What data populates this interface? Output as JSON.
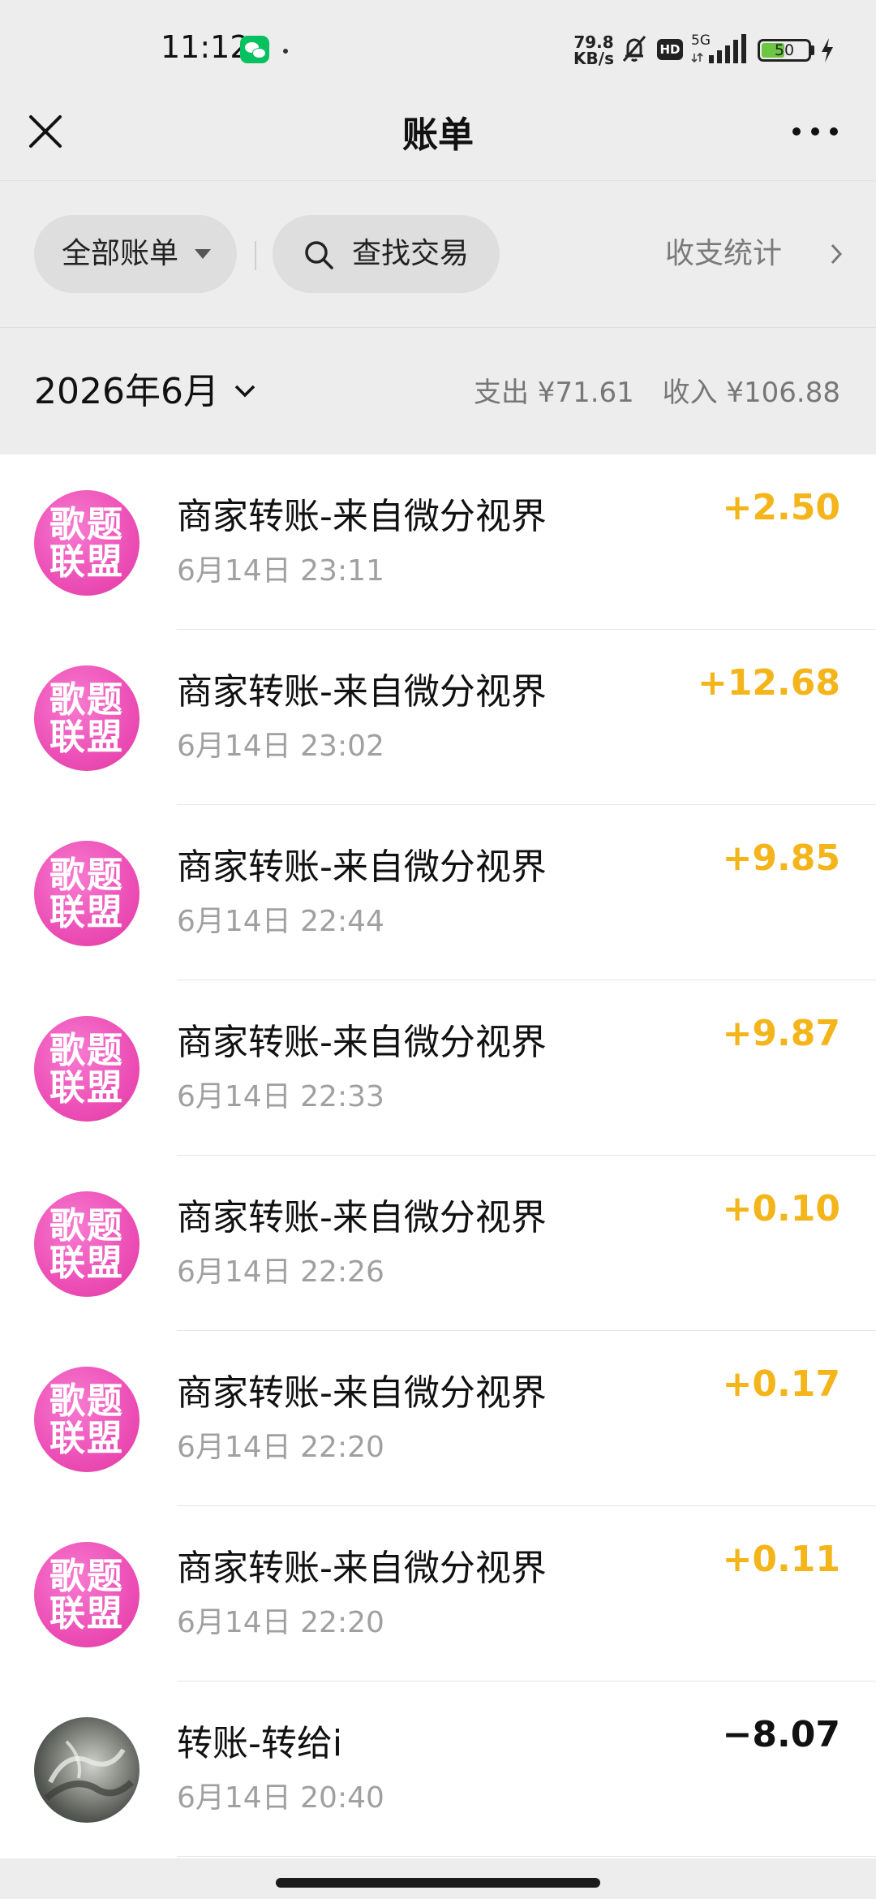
{
  "status_bar": {
    "time": "11:12",
    "net_speed_value": "79.8",
    "net_speed_unit": "KB/s",
    "hd": "HD",
    "network": "5G",
    "battery": "50",
    "battery_level_percent": 50,
    "icons": [
      "wechat-icon",
      "bell-off-icon",
      "signal-icon",
      "battery-icon",
      "charging-icon"
    ]
  },
  "navbar": {
    "title": "账单",
    "left_icon": "close-icon",
    "right_icon": "more-icon"
  },
  "filter": {
    "all_bills_label": "全部账单",
    "search_label": "查找交易",
    "stats_label": "收支统计"
  },
  "month": {
    "label": "2026年6月",
    "expense_summary": "支出 ¥71.61",
    "income_summary": "收入 ¥106.88"
  },
  "transactions": [
    {
      "avatar_text_1": "歌题",
      "avatar_text_2": "联盟",
      "title": "商家转账-来自微分视界",
      "time": "6月14日 23:11",
      "amount": "+2.50"
    },
    {
      "avatar_text_1": "歌题",
      "avatar_text_2": "联盟",
      "title": "商家转账-来自微分视界",
      "time": "6月14日 23:02",
      "amount": "+12.68"
    },
    {
      "avatar_text_1": "歌题",
      "avatar_text_2": "联盟",
      "title": "商家转账-来自微分视界",
      "time": "6月14日 22:44",
      "amount": "+9.85"
    },
    {
      "avatar_text_1": "歌题",
      "avatar_text_2": "联盟",
      "title": "商家转账-来自微分视界",
      "time": "6月14日 22:33",
      "amount": "+9.87"
    },
    {
      "avatar_text_1": "歌题",
      "avatar_text_2": "联盟",
      "title": "商家转账-来自微分视界",
      "time": "6月14日 22:26",
      "amount": "+0.10"
    },
    {
      "avatar_text_1": "歌题",
      "avatar_text_2": "联盟",
      "title": "商家转账-来自微分视界",
      "time": "6月14日 22:20",
      "amount": "+0.17"
    },
    {
      "avatar_text_1": "歌题",
      "avatar_text_2": "联盟",
      "title": "商家转账-来自微分视界",
      "time": "6月14日 22:20",
      "amount": "+0.11"
    },
    {
      "title": "转账-转给i",
      "time": "6月14日 20:40",
      "amount": "−8.07"
    }
  ],
  "colors": {
    "income": "#f3b51a",
    "expense": "#111111",
    "avatar_pink": "#ec4fb6",
    "background": "#ededed"
  }
}
